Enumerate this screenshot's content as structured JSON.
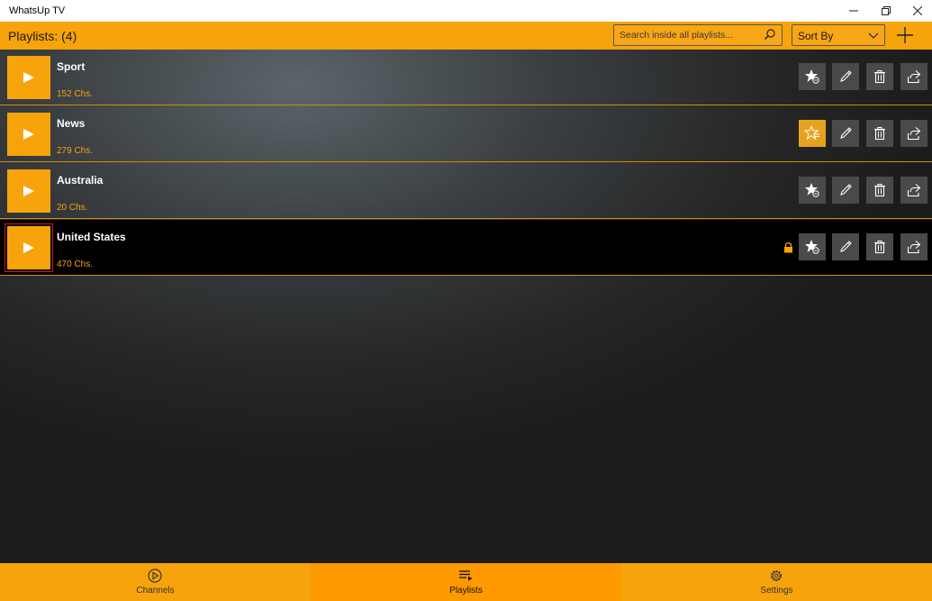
{
  "window": {
    "title": "WhatsUp TV"
  },
  "header": {
    "title": "Playlists: (4)",
    "search_placeholder": "Search inside all playlists...",
    "sort_label": "Sort By"
  },
  "icons": {
    "search": "search-icon",
    "sort": "chevron-down-icon",
    "add": "plus-icon",
    "play": "play-icon",
    "favorite": "star-icon",
    "edit": "pencil-icon",
    "delete": "trash-icon",
    "share": "share-icon",
    "lock": "lock-icon"
  },
  "colors": {
    "accent": "#f7a30b",
    "selected_tab": "#ff9900",
    "fav_active": "#e6a21f"
  },
  "playlists": [
    {
      "name": "Sport",
      "count": "152 Chs.",
      "favorite": false,
      "locked": false,
      "selected": false
    },
    {
      "name": "News",
      "count": "279 Chs.",
      "favorite": true,
      "locked": false,
      "selected": false
    },
    {
      "name": "Australia",
      "count": "20 Chs.",
      "favorite": false,
      "locked": false,
      "selected": false
    },
    {
      "name": "United States",
      "count": "470 Chs.",
      "favorite": false,
      "locked": true,
      "selected": true
    }
  ],
  "nav": {
    "tabs": [
      {
        "label": "Channels",
        "icon": "play-circle-icon",
        "active": false
      },
      {
        "label": "Playlists",
        "icon": "playlist-icon",
        "active": true
      },
      {
        "label": "Settings",
        "icon": "gear-icon",
        "active": false
      }
    ]
  }
}
